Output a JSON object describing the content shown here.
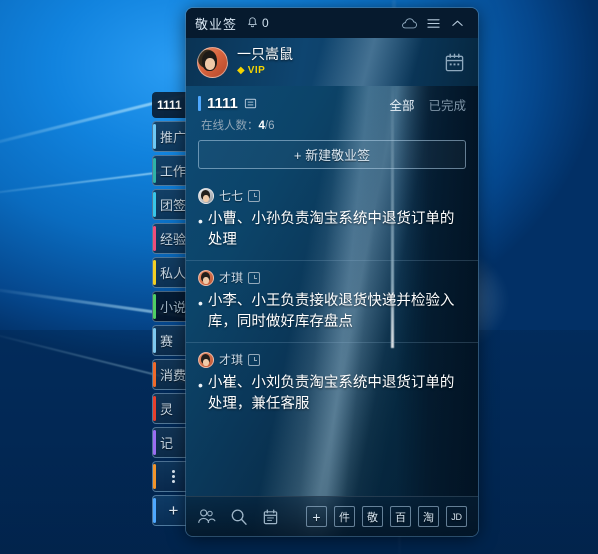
{
  "desktop": {
    "wallpaper": "windows-10-blue-hero"
  },
  "sidebar": {
    "items": [
      {
        "label": "1111",
        "accent": "#ffffff",
        "active": false,
        "first": true
      },
      {
        "label": "推广",
        "accent": "#6ec9f5",
        "active": false
      },
      {
        "label": "工作",
        "accent": "#2fb3a8",
        "active": false
      },
      {
        "label": "团签",
        "accent": "#39c6e8",
        "active": false
      },
      {
        "label": "经验",
        "accent": "#ef4e7b",
        "active": false
      },
      {
        "label": "私人",
        "accent": "#f2d024",
        "active": false
      },
      {
        "label": "小说",
        "accent": "#4fcf64",
        "active": true
      },
      {
        "label": "赛",
        "accent": "#7fc9ef",
        "active": false
      },
      {
        "label": "消费",
        "accent": "#f06a2a",
        "active": false
      },
      {
        "label": "灵",
        "accent": "#e8402c",
        "active": false
      },
      {
        "label": "记",
        "accent": "#9b6ef3",
        "active": false
      },
      {
        "label": "⋮",
        "accent": "#f2952b",
        "active": false,
        "kind": "more"
      },
      {
        "label": "+",
        "accent": "#4ea8ff",
        "active": false,
        "kind": "plus"
      }
    ]
  },
  "window": {
    "titlebar": {
      "app_title": "敬业签",
      "bell_icon": "bell-icon",
      "notification_count": "0",
      "cloud_icon": "cloud-icon",
      "menu_icon": "hamburger-menu-icon",
      "collapse_icon": "chevron-up-icon"
    },
    "profile": {
      "avatar": "user-avatar",
      "name": "一只嵩鼠",
      "vip_gem_icon": "diamond-icon",
      "vip_label": "VIP",
      "calendar_icon": "calendar-icon"
    },
    "group_header": {
      "title": "1111",
      "list_icon": "list-icon",
      "filters": [
        {
          "label": "全部",
          "selected": true
        },
        {
          "label": "已完成",
          "selected": false
        }
      ],
      "online_label": "在线人数：",
      "online_current": "4",
      "online_total": "/6"
    },
    "new_button": {
      "label": "+ 新建敬业签"
    },
    "notes": [
      {
        "author": "七七",
        "avatar_style": "grey",
        "reminder_icon": "clock-icon",
        "text": "小曹、小孙负责淘宝系统中退货订单的处理"
      },
      {
        "author": "才琪",
        "avatar_style": "orange",
        "reminder_icon": "clock-icon",
        "text": "小李、小王负责接收退货快递并检验入库，同时做好库存盘点"
      },
      {
        "author": "才琪",
        "avatar_style": "orange",
        "reminder_icon": "clock-icon",
        "text": "小崔、小刘负责淘宝系统中退货订单的处理，兼任客服"
      }
    ],
    "bottombar": {
      "left_icons": [
        {
          "name": "contacts-icon"
        },
        {
          "name": "search-icon"
        },
        {
          "name": "calendar-icon"
        }
      ],
      "right_buttons": [
        {
          "label": "+",
          "name": "add-shortcut-button"
        },
        {
          "label": "件",
          "name": "mail-shortcut-button"
        },
        {
          "label": "敬",
          "name": "jingye-shortcut-button"
        },
        {
          "label": "百",
          "name": "baidu-shortcut-button"
        },
        {
          "label": "淘",
          "name": "taobao-shortcut-button"
        },
        {
          "label": "JD",
          "name": "jd-shortcut-button"
        }
      ]
    }
  },
  "colors": {
    "accent_blue": "#4ea8ff",
    "vip_gold": "#f5d400",
    "titlebar_bg": "#061a2e"
  }
}
